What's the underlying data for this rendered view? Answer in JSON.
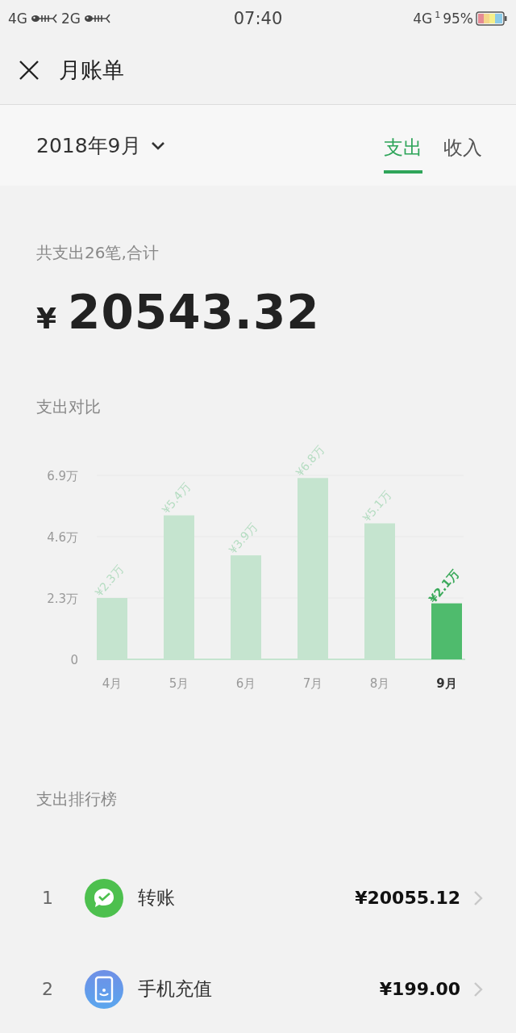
{
  "status_bar": {
    "left": [
      {
        "kind": "net",
        "text": "4G"
      },
      {
        "kind": "signal"
      },
      {
        "kind": "net",
        "text": "2G"
      },
      {
        "kind": "signal"
      }
    ],
    "time": "07:40",
    "right": [
      {
        "kind": "net",
        "text": "4G"
      },
      {
        "kind": "sub",
        "text": "1"
      },
      {
        "kind": "battery_text",
        "text": "95%"
      },
      {
        "kind": "battery"
      }
    ]
  },
  "header": {
    "title": "月账单"
  },
  "filter": {
    "month": "2018年9月",
    "tabs": [
      {
        "label": "支出",
        "selected": true
      },
      {
        "label": "收入",
        "selected": false
      }
    ]
  },
  "summary": {
    "label": "共支出26笔,合计",
    "currency": "¥",
    "amount": "20543.32"
  },
  "comparison": {
    "title": "支出对比",
    "chart_data": {
      "type": "bar",
      "categories": [
        "4月",
        "5月",
        "6月",
        "7月",
        "8月",
        "9月"
      ],
      "ylim": [
        0,
        6.9
      ],
      "yticks": [
        {
          "value": 0,
          "label": "0"
        },
        {
          "value": 2.3,
          "label": "2.3万"
        },
        {
          "value": 4.6,
          "label": "4.6万"
        },
        {
          "value": 6.9,
          "label": "6.9万"
        }
      ],
      "series": [
        {
          "color": "#c5e4cf",
          "values": [
            2.3,
            5.4,
            3.9,
            6.8,
            5.1,
            null
          ]
        },
        {
          "color": "#4fbb6d",
          "values": [
            null,
            null,
            null,
            null,
            null,
            2.1
          ]
        }
      ],
      "value_labels": [
        "¥2.3万",
        "¥5.4万",
        "¥3.9万",
        "¥6.8万",
        "¥5.1万",
        "¥2.1万"
      ]
    }
  },
  "ranking": {
    "title": "支出排行榜",
    "items": [
      {
        "rank": "1",
        "kind": "transfer",
        "name": "转账",
        "amount": "¥20055.12"
      },
      {
        "rank": "2",
        "kind": "phone",
        "name": "手机充值",
        "amount": "¥199.00"
      }
    ]
  }
}
